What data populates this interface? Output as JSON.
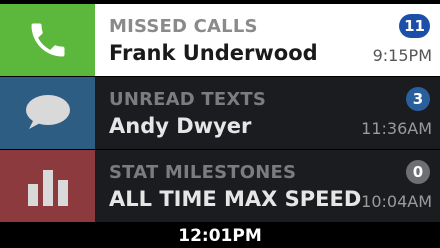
{
  "notifications": [
    {
      "category": "MISSED CALLS",
      "name": "Frank Underwood",
      "time": "9:15PM",
      "badge": "11",
      "icon": "phone-icon",
      "tile_color": "#5cb83c",
      "badge_color": "#1c4fa8"
    },
    {
      "category": "UNREAD TEXTS",
      "name": "Andy Dwyer",
      "time": "11:36AM",
      "badge": "3",
      "icon": "message-bubble-icon",
      "tile_color": "#2e5d84",
      "badge_color": "#2a5f9e"
    },
    {
      "category": "STAT MILESTONES",
      "name": "ALL TIME MAX SPEED",
      "time": "10:04AM",
      "badge": "0",
      "icon": "bar-chart-icon",
      "tile_color": "#8c3a3e",
      "badge_color": "#6e6f73"
    }
  ],
  "status_bar": {
    "clock": "12:01PM"
  }
}
